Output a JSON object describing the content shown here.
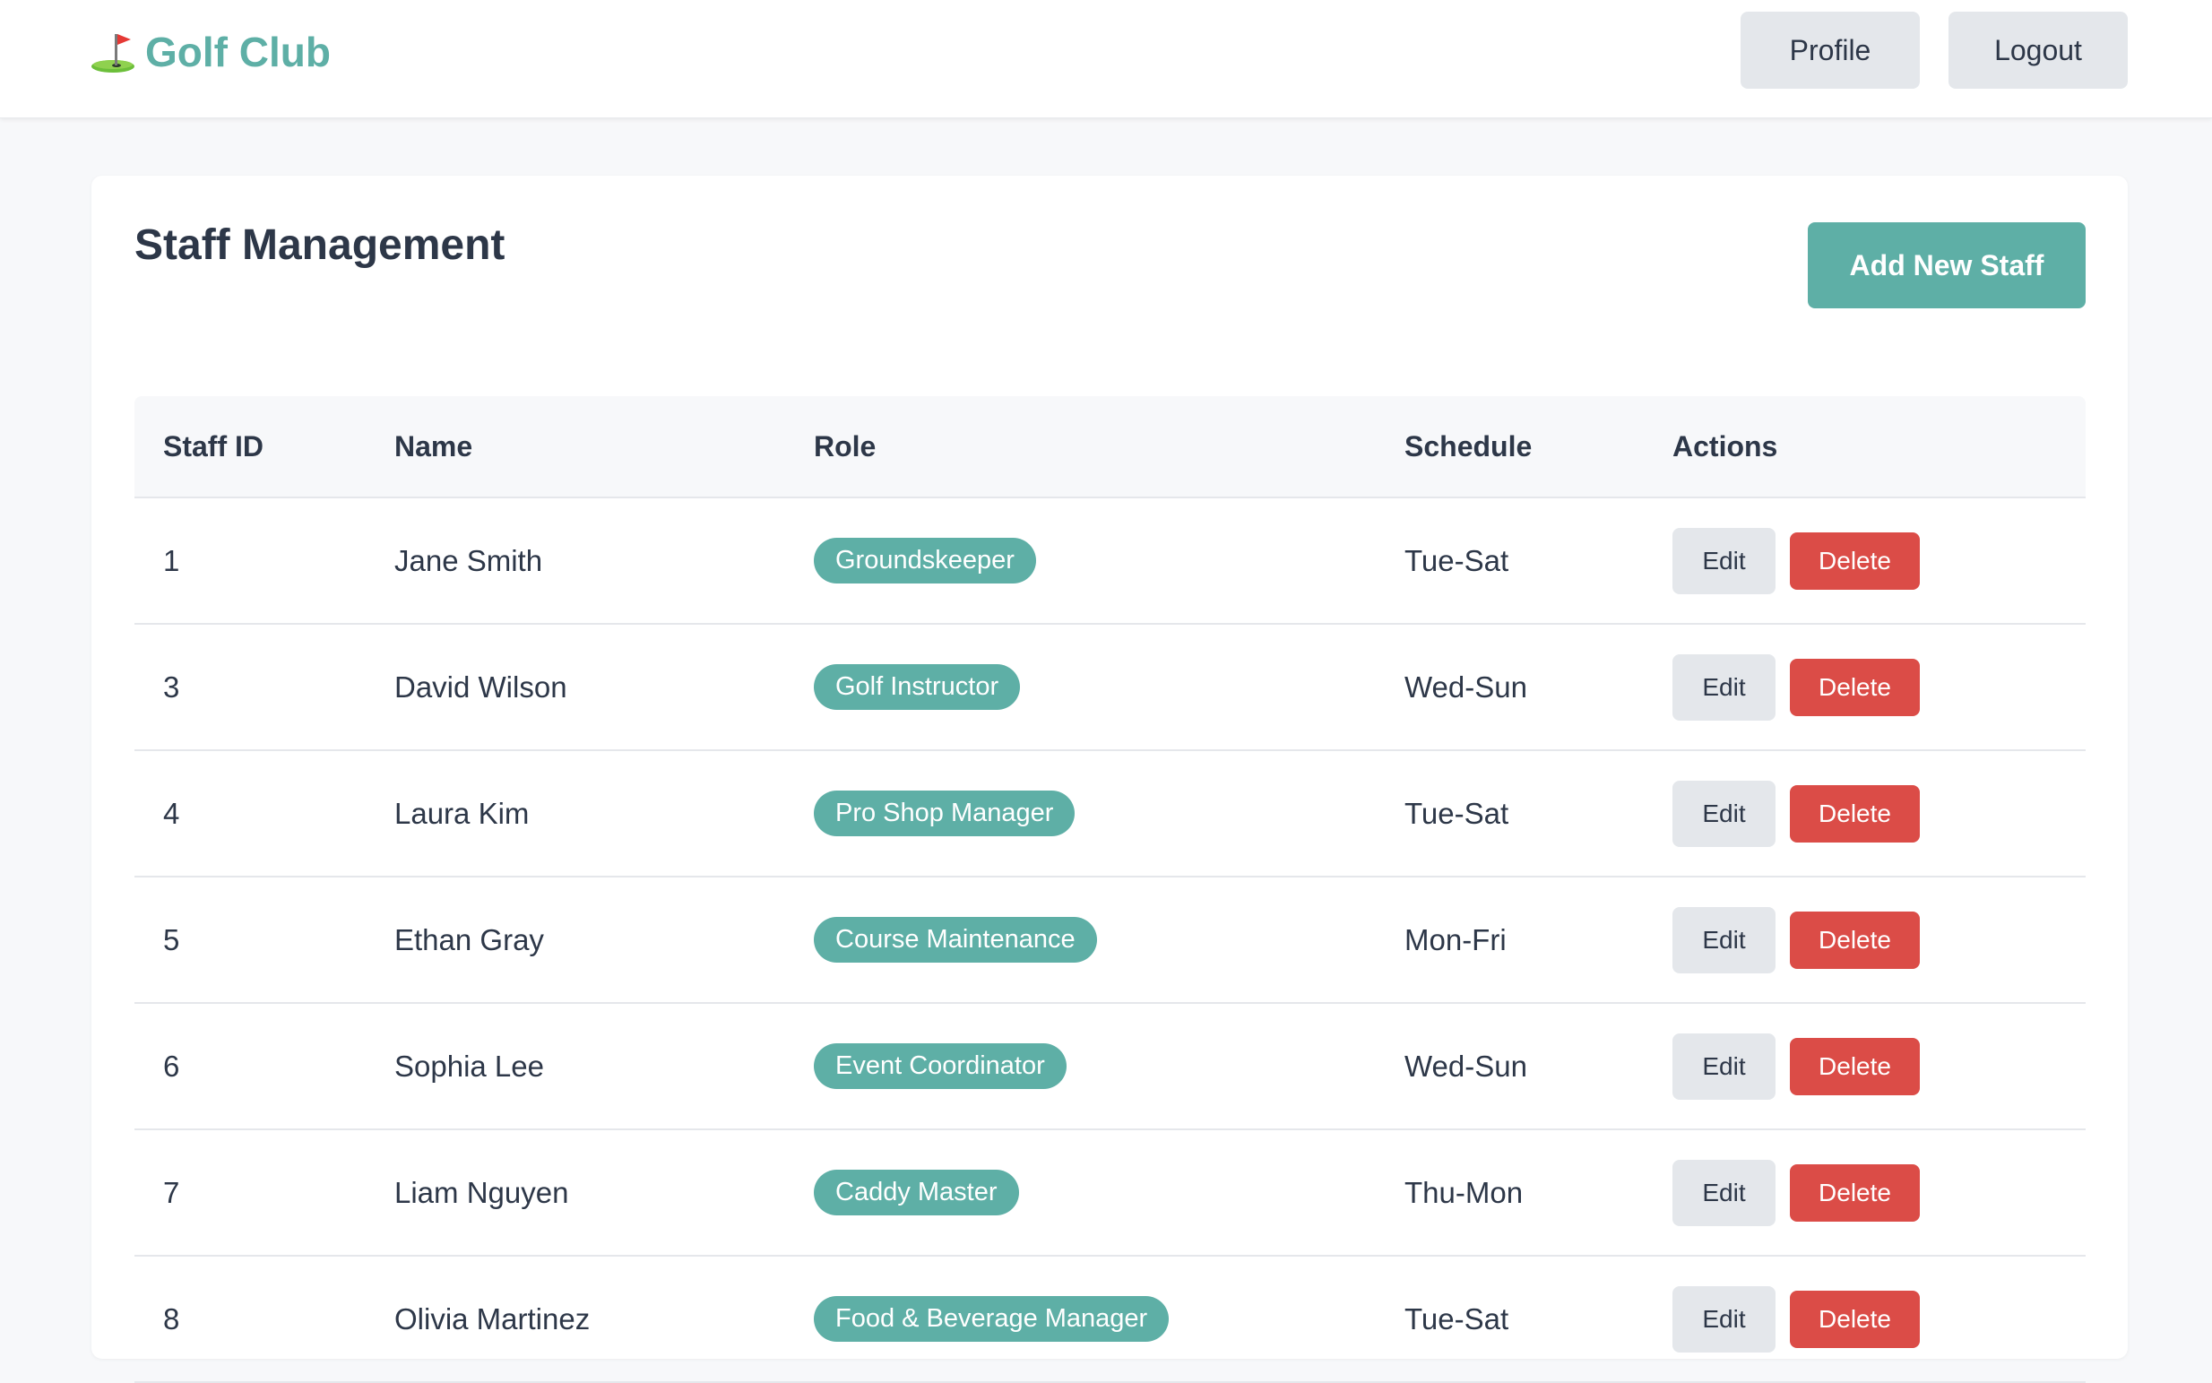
{
  "header": {
    "brand_icon": "golf-flag-icon",
    "brand": "Golf Club",
    "profile_label": "Profile",
    "logout_label": "Logout"
  },
  "main": {
    "title": "Staff Management",
    "add_label": "Add New Staff"
  },
  "table": {
    "columns": [
      "Staff ID",
      "Name",
      "Role",
      "Schedule",
      "Actions"
    ],
    "rows": [
      {
        "id": "1",
        "name": "Jane Smith",
        "role": "Groundskeeper",
        "schedule": "Tue-Sat",
        "edit": "Edit",
        "delete": "Delete"
      },
      {
        "id": "3",
        "name": "David Wilson",
        "role": "Golf Instructor",
        "schedule": "Wed-Sun",
        "edit": "Edit",
        "delete": "Delete"
      },
      {
        "id": "4",
        "name": "Laura Kim",
        "role": "Pro Shop Manager",
        "schedule": "Tue-Sat",
        "edit": "Edit",
        "delete": "Delete"
      },
      {
        "id": "5",
        "name": "Ethan Gray",
        "role": "Course Maintenance",
        "schedule": "Mon-Fri",
        "edit": "Edit",
        "delete": "Delete"
      },
      {
        "id": "6",
        "name": "Sophia Lee",
        "role": "Event Coordinator",
        "schedule": "Wed-Sun",
        "edit": "Edit",
        "delete": "Delete"
      },
      {
        "id": "7",
        "name": "Liam Nguyen",
        "role": "Caddy Master",
        "schedule": "Thu-Mon",
        "edit": "Edit",
        "delete": "Delete"
      },
      {
        "id": "8",
        "name": "Olivia Martinez",
        "role": "Food & Beverage Manager",
        "schedule": "Tue-Sat",
        "edit": "Edit",
        "delete": "Delete"
      }
    ]
  },
  "colors": {
    "accent": "#5eafa6",
    "danger": "#db4c47",
    "neutral_button": "#e4e7eb",
    "text": "#2d3748",
    "background": "#f7f8fa"
  }
}
